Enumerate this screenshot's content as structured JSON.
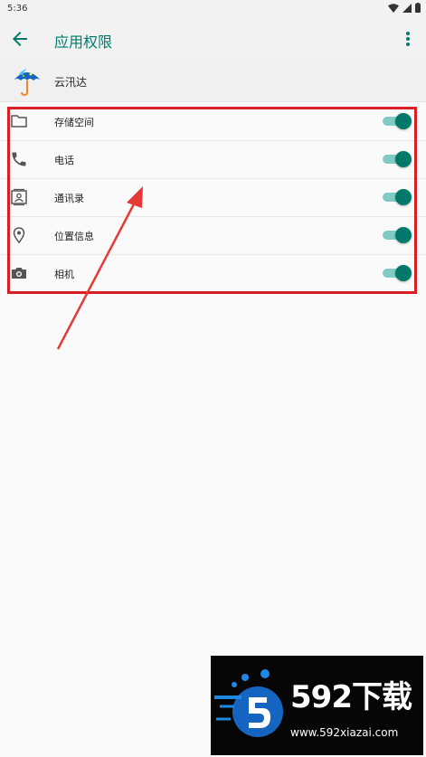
{
  "status_bar": {
    "time": "5:36"
  },
  "app_bar": {
    "title": "应用权限"
  },
  "app": {
    "name": "云汛达"
  },
  "permissions": [
    {
      "label": "存储空间",
      "icon": "folder-icon",
      "enabled": true
    },
    {
      "label": "电话",
      "icon": "phone-icon",
      "enabled": true
    },
    {
      "label": "通讯录",
      "icon": "contacts-icon",
      "enabled": true
    },
    {
      "label": "位置信息",
      "icon": "location-icon",
      "enabled": true
    },
    {
      "label": "相机",
      "icon": "camera-icon",
      "enabled": true
    }
  ],
  "colors": {
    "accent": "#00796b",
    "toggle_track": "#80cbc4",
    "annotation": "#d81f26"
  },
  "watermark": {
    "title": "592下载",
    "url": "www.592xiazai.com"
  }
}
